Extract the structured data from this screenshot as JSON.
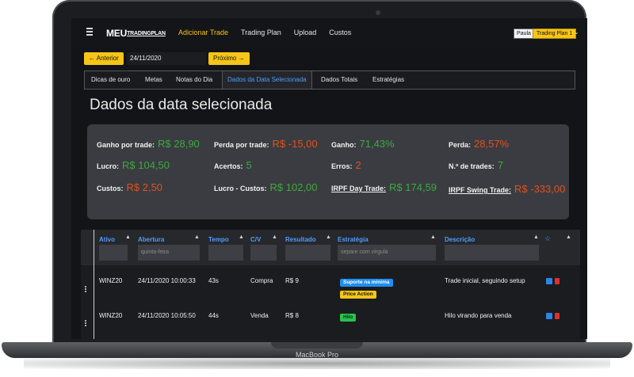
{
  "device": {
    "label": "MacBook Pro"
  },
  "navbar": {
    "brand_main": "MEU",
    "brand_sub": "TRADINGPLAN",
    "links": [
      {
        "label": "Adicionar Trade",
        "active": true
      },
      {
        "label": "Trading Plan",
        "active": false
      },
      {
        "label": "Upload",
        "active": false
      },
      {
        "label": "Custos",
        "active": false
      }
    ],
    "user": "Paula",
    "plan": "Trading Plan 1"
  },
  "date_nav": {
    "prev_label": "← Anterior",
    "date_value": "24/11/2020",
    "next_label": "Próximo →"
  },
  "tabs": [
    {
      "label": "Dicas de ouro",
      "active": false
    },
    {
      "label": "Metas",
      "active": false
    },
    {
      "label": "Notas do Dia",
      "active": false
    },
    {
      "label": "Dados da Data Selecionada",
      "active": true
    },
    {
      "label": "Dados Totais",
      "active": false
    },
    {
      "label": "Estratégias",
      "active": false
    }
  ],
  "page_title": "Dados da data selecionada",
  "stats": {
    "ganho_por_trade": {
      "label": "Ganho por trade:",
      "value": "R$ 28,90"
    },
    "perda_por_trade": {
      "label": "Perda por trade:",
      "value": "R$ -15,00"
    },
    "ganho": {
      "label": "Ganho:",
      "value": "71,43%"
    },
    "perda": {
      "label": "Perda:",
      "value": "28,57%"
    },
    "lucro": {
      "label": "Lucro:",
      "value": "R$ 104,50"
    },
    "acertos": {
      "label": "Acertos:",
      "value": "5"
    },
    "erros": {
      "label": "Erros:",
      "value": "2"
    },
    "n_trades": {
      "label": "N.º de trades:",
      "value": "7"
    },
    "custos": {
      "label": "Custos:",
      "value": "R$ 2,50"
    },
    "lucro_custos": {
      "label": "Lucro - Custos:",
      "value": "R$ 102,00"
    },
    "irpf_day": {
      "label": "IRPF Day Trade:",
      "value": "R$ 174,59"
    },
    "irpf_swing": {
      "label": "IRPF Swing Trade:",
      "value": "R$ -333,00"
    }
  },
  "table": {
    "columns": [
      "Ativo",
      "Abertura",
      "Tempo",
      "C/V",
      "Resultado",
      "Estratégia",
      "Descrição"
    ],
    "filters": {
      "abertura_placeholder": "quinta-feira",
      "estrategia_placeholder": "separe com vírgula"
    },
    "rows": [
      {
        "ativo": "WINZ20",
        "abertura": "24/11/2020 10:00:33",
        "tempo": "43s",
        "cv": "Compra",
        "resultado": "R$ 9",
        "tags": [
          {
            "label": "Suporte na mínima",
            "color": "blue"
          },
          {
            "label": "Price Action",
            "color": "yellow"
          }
        ],
        "descricao": "Trade inicial, seguindo setup"
      },
      {
        "ativo": "WINZ20",
        "abertura": "24/11/2020 10:05:50",
        "tempo": "44s",
        "cv": "Venda",
        "resultado": "R$ 8",
        "tags": [
          {
            "label": "Hilo",
            "color": "green"
          }
        ],
        "descricao": "Hilo virando para venda"
      }
    ]
  },
  "colors": {
    "accent": "#f5c518",
    "link": "#4f9cff",
    "positive": "#3fa83f",
    "negative": "#e0511f"
  }
}
